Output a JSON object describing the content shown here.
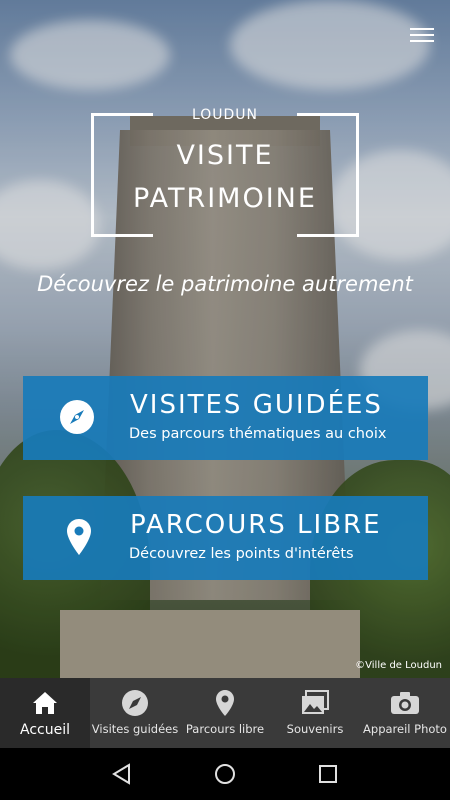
{
  "header": {
    "menu_icon": "hamburger-menu-icon",
    "city": "LOUDUN",
    "title_line1": "VISITE",
    "title_line2": "PATRIMOINE"
  },
  "tagline": "Découvrez le patrimoine autrement",
  "cards": [
    {
      "icon": "compass-icon",
      "title": "VISITES GUIDÉES",
      "subtitle": "Des parcours thématiques au choix"
    },
    {
      "icon": "location-pin-icon",
      "title": "PARCOURS LIBRE",
      "subtitle": "Découvrez les points d'intérêts"
    }
  ],
  "credit": "©Ville de Loudun",
  "bottom_nav": [
    {
      "icon": "home-icon",
      "label": "Accueil",
      "active": true
    },
    {
      "icon": "compass-icon",
      "label": "Visites guidées",
      "active": false
    },
    {
      "icon": "location-pin-icon",
      "label": "Parcours libre",
      "active": false
    },
    {
      "icon": "photo-album-icon",
      "label": "Souvenirs",
      "active": false
    },
    {
      "icon": "camera-icon",
      "label": "Appareil Photo",
      "active": false
    }
  ],
  "system_nav": [
    "back-icon",
    "home-circle-icon",
    "recents-icon"
  ],
  "colors": {
    "card_blue": "#187bba",
    "nav_bg": "#3a3a3a"
  }
}
